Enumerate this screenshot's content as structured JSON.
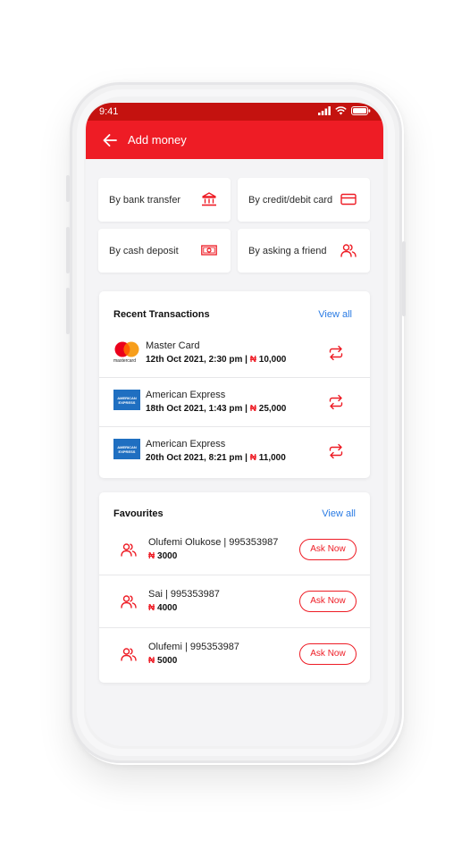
{
  "status_bar": {
    "time": "9:41"
  },
  "header": {
    "title": "Add money"
  },
  "options": [
    {
      "label": "By bank transfer",
      "icon": "bank-icon"
    },
    {
      "label": "By credit/debit card",
      "icon": "card-icon"
    },
    {
      "label": "By cash deposit",
      "icon": "cash-icon"
    },
    {
      "label": "By asking a friend",
      "icon": "friends-icon"
    }
  ],
  "recent": {
    "title": "Recent Transactions",
    "view_all": "View all",
    "items": [
      {
        "name": "Master Card",
        "date": "12th Oct 2021, 2:30 pm | ",
        "currency": "₦",
        "amount": " 10,000",
        "logo": "mastercard-logo",
        "logo_text": "mastercard"
      },
      {
        "name": "American Express",
        "date": "18th Oct 2021, 1:43 pm | ",
        "currency": "₦",
        "amount": " 25,000",
        "logo": "amex-logo",
        "logo_text": "AMERICAN EXPRESS"
      },
      {
        "name": "American Express",
        "date": "20th Oct 2021, 8:21 pm | ",
        "currency": "₦",
        "amount": " 11,000",
        "logo": "amex-logo",
        "logo_text": "AMERICAN EXPRESS"
      }
    ]
  },
  "favourites": {
    "title": "Favourites",
    "view_all": "View all",
    "items": [
      {
        "name": "Olufemi Olukose | 995353987",
        "currency": "₦",
        "amount": " 3000",
        "button": "Ask Now"
      },
      {
        "name": "Sai | 995353987",
        "currency": "₦",
        "amount": " 4000",
        "button": "Ask Now"
      },
      {
        "name": "Olufemi | 995353987",
        "currency": "₦",
        "amount": " 5000",
        "button": "Ask Now"
      }
    ]
  },
  "colors": {
    "brand_red": "#ee1c25",
    "status_red": "#c4120f",
    "link_blue": "#2a7be4",
    "amex_blue": "#1f6fc1"
  }
}
